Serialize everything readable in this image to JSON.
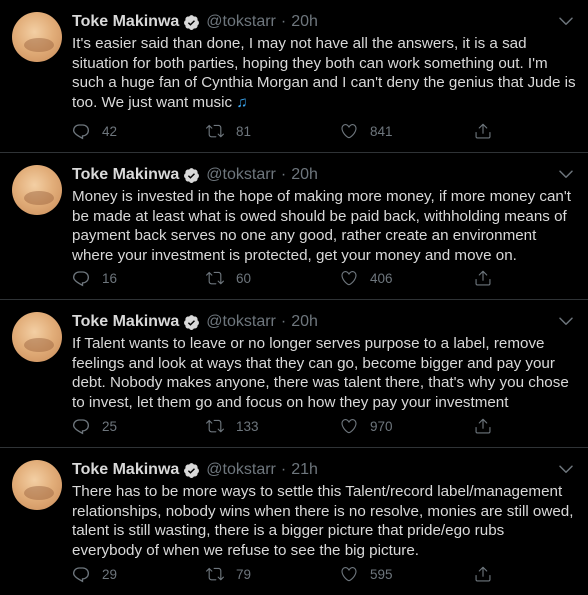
{
  "tweets": [
    {
      "name": "Toke Makinwa",
      "handle": "@tokstarr",
      "separator": "·",
      "time": "20h",
      "text": "It's easier said than done, I may not have all the answers, it is a sad situation for both parties, hoping they both can work something out. I'm such a huge fan of Cynthia Morgan and I can't deny the genius that Jude is too. We just want music",
      "emoji": "♫",
      "replies": "42",
      "retweets": "81",
      "likes": "841"
    },
    {
      "name": "Toke Makinwa",
      "handle": "@tokstarr",
      "separator": "·",
      "time": "20h",
      "text": "Money is invested in the hope of making more money, if more money can't be made at least what is owed should be paid back, withholding means of payment back serves no one any good, rather create an environment where your investment is protected, get your money and move on.",
      "replies": "16",
      "retweets": "60",
      "likes": "406"
    },
    {
      "name": "Toke Makinwa",
      "handle": "@tokstarr",
      "separator": "·",
      "time": "20h",
      "text": "If Talent wants to leave or no longer serves purpose to a label, remove feelings and look at ways that they can go, become bigger and pay your debt. Nobody makes anyone, there was talent there, that's why you chose to invest, let them go and focus on how they pay your investment",
      "replies": "25",
      "retweets": "133",
      "likes": "970"
    },
    {
      "name": "Toke Makinwa",
      "handle": "@tokstarr",
      "separator": "·",
      "time": "21h",
      "text": "There has to be more ways to settle this Talent/record label/management relationships, nobody wins when there is no resolve, monies are still owed, talent is still wasting, there is a bigger picture that pride/ego rubs everybody of when we refuse to see the big picture.",
      "replies": "29",
      "retweets": "79",
      "likes": "595"
    }
  ],
  "colors": {
    "background": "#000000",
    "text": "#d9d9d9",
    "muted": "#6e767d",
    "divider": "#2f3336",
    "verified": "#d9d9d9"
  },
  "icons": [
    "more-icon",
    "verified-icon",
    "reply-icon",
    "retweet-icon",
    "like-icon",
    "share-icon",
    "music-note-icon"
  ]
}
